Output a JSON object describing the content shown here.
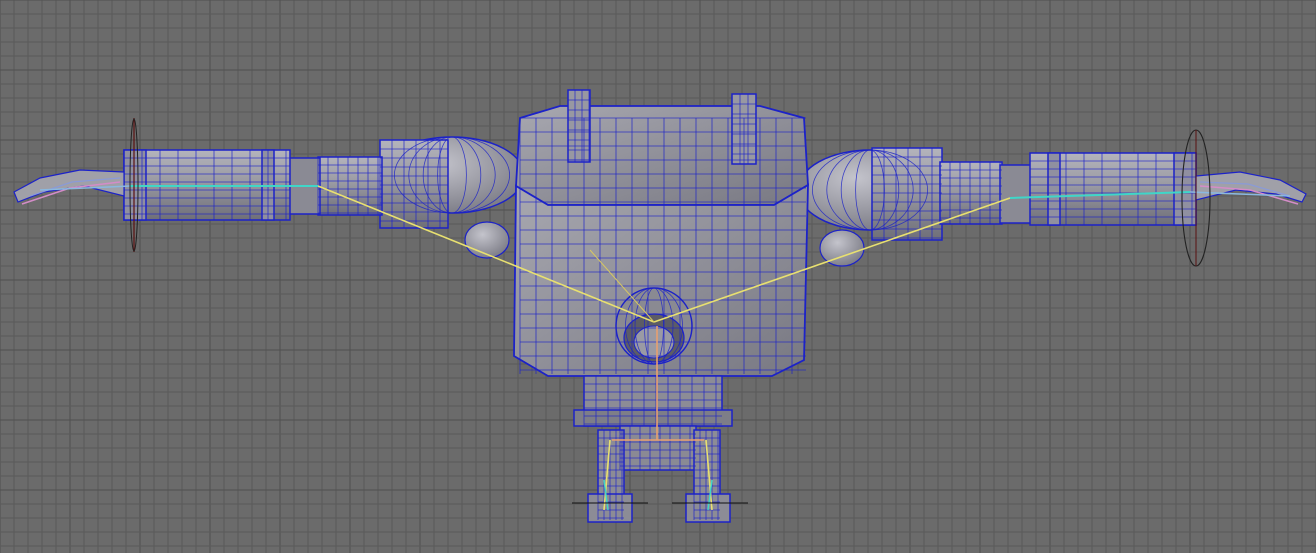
{
  "viewport": {
    "view": "front",
    "shading": "wireframe-on-shaded",
    "grid_visible": true
  },
  "colors": {
    "background": "#6b6b6b",
    "grid_line": "#5a5a5a",
    "grid_major": "#4f4f4f",
    "mesh_fill": "#9c9ca4",
    "mesh_shade": "#7c7c86",
    "wire": "#1c22c8",
    "wire_dark": "#0d1390",
    "bone_yellow": "#e8e070",
    "bone_cyan": "#3fd6c8",
    "bone_pink": "#d48cc8",
    "bone_orange": "#e8a070",
    "manip_black": "#111111"
  },
  "scene": {
    "character": "robot-rig",
    "selected": true
  }
}
